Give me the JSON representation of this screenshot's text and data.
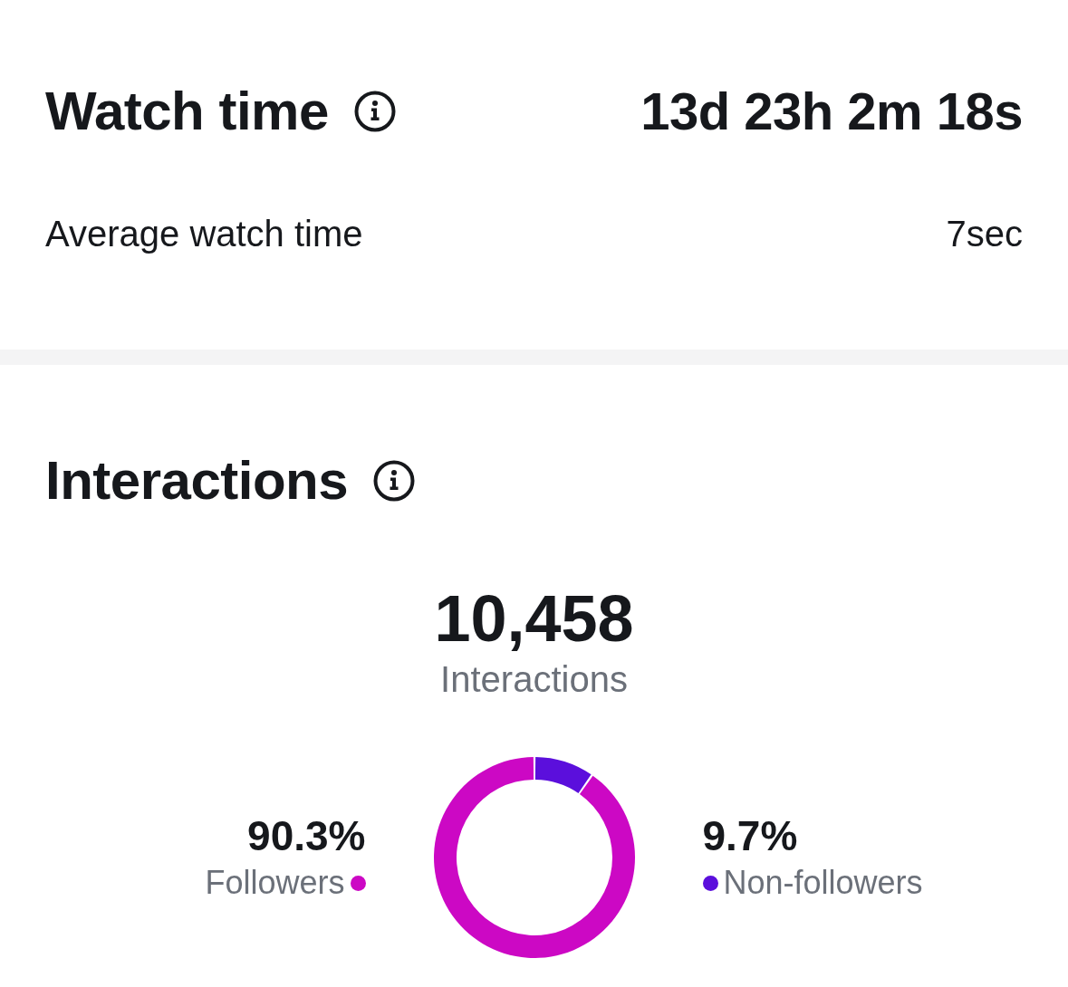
{
  "watch_time": {
    "title": "Watch time",
    "value": "13d 23h 2m 18s",
    "average_label": "Average watch time",
    "average_value": "7sec"
  },
  "interactions": {
    "title": "Interactions",
    "total": "10,458",
    "total_label": "Interactions",
    "chart_data": {
      "type": "donut",
      "categories": [
        "Followers",
        "Non-followers"
      ],
      "values": [
        90.3,
        9.7
      ],
      "value_labels": [
        "90.3%",
        "9.7%"
      ]
    },
    "legend": [
      {
        "color": "#cc08c4"
      },
      {
        "color": "#5b0fdc"
      }
    ]
  }
}
